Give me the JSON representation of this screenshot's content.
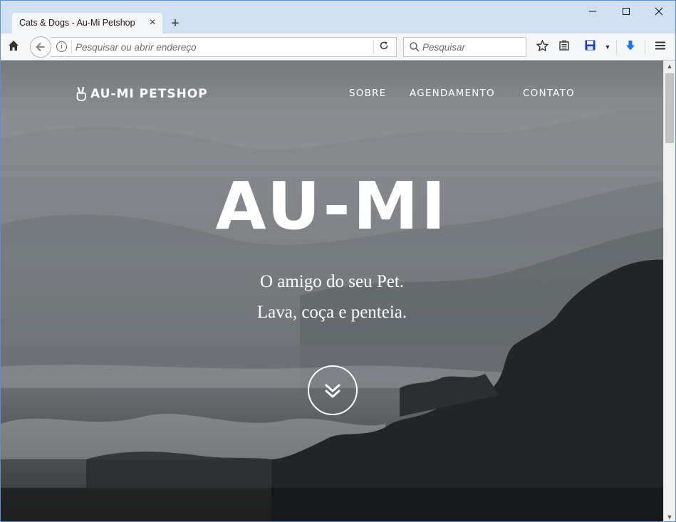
{
  "browser": {
    "tab_title": "Cats & Dogs - Au-Mi Petshop",
    "url_placeholder": "Pesquisar ou abrir endereço",
    "search_placeholder": "Pesquisar",
    "window_controls": {
      "minimize": "—",
      "maximize": "☐",
      "close": "✕"
    }
  },
  "site": {
    "brand": "AU-MI PETSHOP",
    "nav": [
      {
        "label": "SOBRE"
      },
      {
        "label": "AGENDAMENTO"
      },
      {
        "label": "CONTATO"
      }
    ],
    "hero": {
      "title": "AU-MI",
      "lines": [
        "O amigo do seu Pet.",
        "Lava, coça e penteia."
      ]
    }
  },
  "icons": {
    "home": "home-icon",
    "back": "back-arrow-icon",
    "info": "info-icon",
    "reload": "reload-icon",
    "search": "search-icon",
    "bookmark": "star-icon",
    "reader": "reader-icon",
    "save": "save-icon",
    "download": "download-icon",
    "menu": "hamburger-icon",
    "brand": "peace-hand-icon",
    "scroll": "double-chevron-down-icon"
  },
  "colors": {
    "accent_download": "#1a73e8",
    "save_icon": "#1a3fb0",
    "hero_text": "#ffffff"
  }
}
